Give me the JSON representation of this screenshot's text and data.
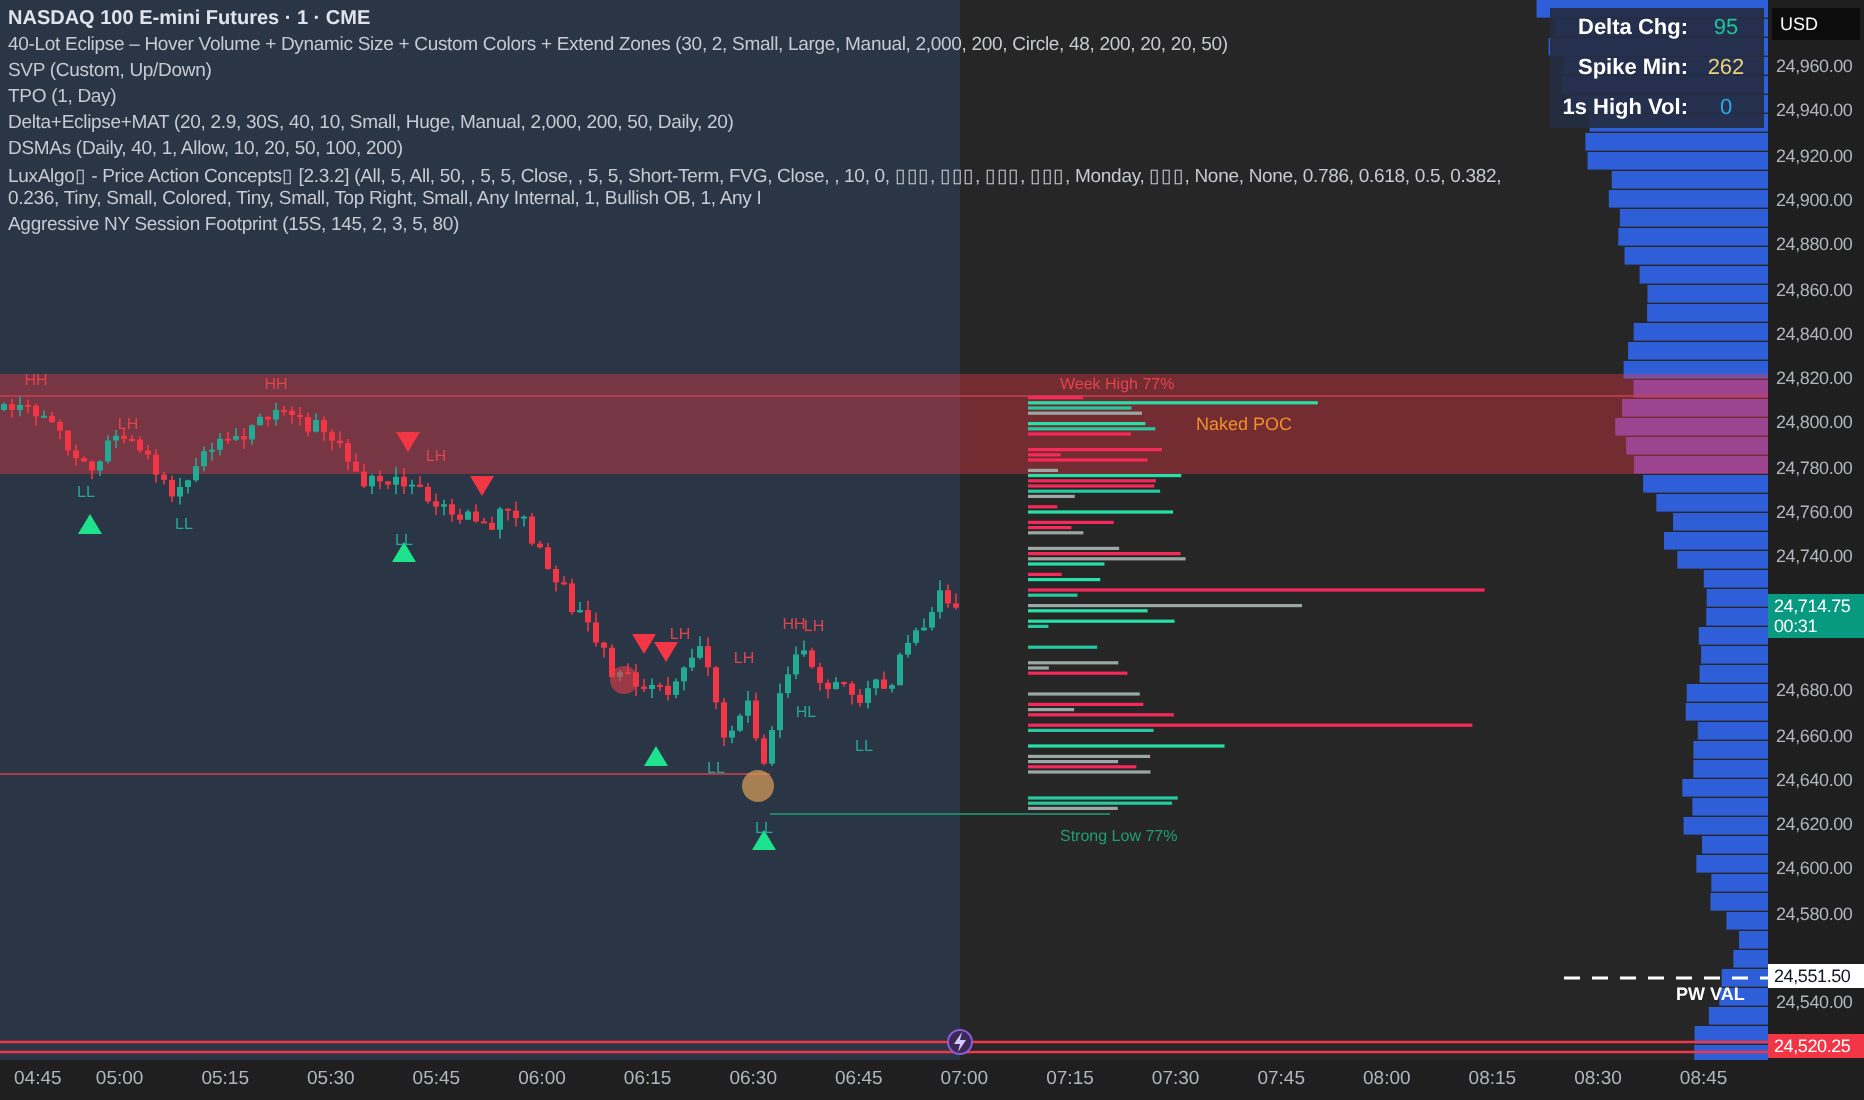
{
  "legend": {
    "title": "NASDAQ 100 E-mini Futures · 1 · CME",
    "indicators": [
      "40-Lot Eclipse – Hover Volume + Dynamic Size + Custom Colors + Extend Zones (30, 2, Small, Large, Manual, 2,000, 200, Circle, 48, 200, 20, 20, 50)",
      "SVP (Custom, Up/Down)",
      "TPO (1, Day)",
      "Delta+Eclipse+MAT (20, 2.9, 30S, 40, 10, Small, Huge, Manual, 2,000, 200, 50, Daily, 20)",
      "DSMAs (Daily, 40, 1, Allow, 10, 20, 50, 100, 200)",
      "LuxAlgo▯ - Price Action Concepts▯ [2.3.2] (All, 5, All, 50, , 5, 5, Close, , 5, 5, Short-Term, FVG, Close, , 10, 0, ▯▯▯, ▯▯▯, ▯▯▯, ▯▯▯, Monday, ▯▯▯, None, None, 0.786, 0.618, 0.5, 0.382, 0.236, Tiny, Small, Colored, Tiny, Small, Top Right, Small, Any Internal, 1, Bullish OB, 1, Any I",
      "Aggressive NY Session Footprint (15S, 145, 2, 3, 5, 80)"
    ]
  },
  "stats_table": [
    {
      "label": "Delta Chg:",
      "value": "95",
      "color": "#22c39a"
    },
    {
      "label": "Spike Min:",
      "value": "262",
      "color": "#e8d27a"
    },
    {
      "label": "1s High Vol:",
      "value": "0",
      "color": "#2aa8e8"
    }
  ],
  "structure_labels": [
    {
      "text": "HH",
      "kind": "bear"
    },
    {
      "text": "LH",
      "kind": "bear"
    },
    {
      "text": "HH",
      "kind": "bear"
    },
    {
      "text": "LH",
      "kind": "bear"
    },
    {
      "text": "LL",
      "kind": "bull"
    },
    {
      "text": "LL",
      "kind": "bull"
    },
    {
      "text": "LL",
      "kind": "bull"
    },
    {
      "text": "LH",
      "kind": "bear"
    },
    {
      "text": "HH",
      "kind": "bear"
    },
    {
      "text": "LH",
      "kind": "bear"
    },
    {
      "text": "LH",
      "kind": "bear"
    },
    {
      "text": "HL",
      "kind": "bull"
    },
    {
      "text": "LL",
      "kind": "bull"
    },
    {
      "text": "LL",
      "kind": "bull"
    },
    {
      "text": "LL",
      "kind": "bull"
    }
  ],
  "level_labels": [
    {
      "text": "Week High 77%",
      "kind": "high"
    },
    {
      "text": "Naked POC",
      "kind": "poc"
    },
    {
      "text": "Strong Low 77%",
      "kind": "low"
    },
    {
      "text": "PW VAL",
      "kind": "val"
    }
  ],
  "price_axis": {
    "currency": "USD",
    "ticks": [
      "24,960.00",
      "24,940.00",
      "24,920.00",
      "24,900.00",
      "24,880.00",
      "24,860.00",
      "24,840.00",
      "24,820.00",
      "24,800.00",
      "24,780.00",
      "24,760.00",
      "24,740.00",
      "24,680.00",
      "24,660.00",
      "24,640.00",
      "24,620.00",
      "24,600.00",
      "24,580.00",
      "24,540.00"
    ]
  },
  "price_tags": [
    {
      "kind": "last",
      "price": "24,714.75",
      "countdown": "00:31"
    },
    {
      "kind": "level",
      "price": "24,551.50"
    },
    {
      "kind": "low",
      "price": "24,520.25"
    }
  ],
  "time_axis": [
    "04:45",
    "05:00",
    "05:15",
    "05:30",
    "05:45",
    "06:00",
    "06:15",
    "06:30",
    "06:45",
    "07:00",
    "07:15",
    "07:30",
    "07:45",
    "08:00",
    "08:15",
    "08:30",
    "08:45"
  ]
}
